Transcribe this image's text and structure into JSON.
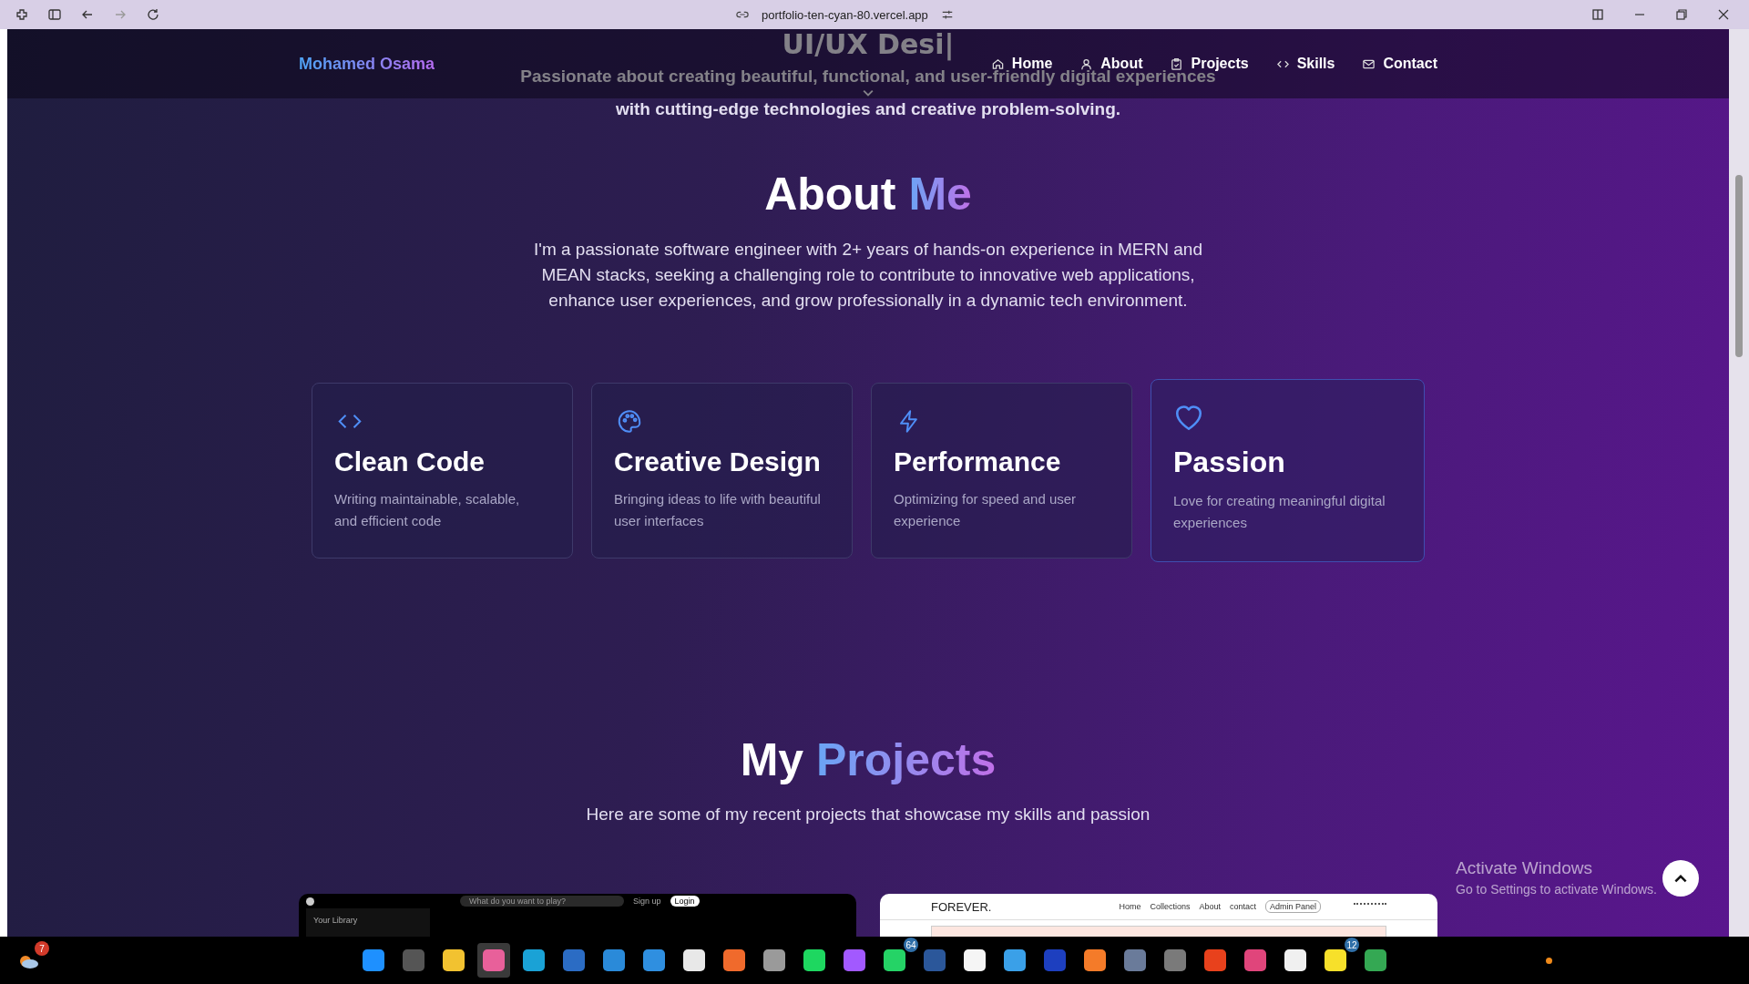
{
  "browser": {
    "address": "portfolio-ten-cyan-80.vercel.app"
  },
  "nav": {
    "logo": "Mohamed Osama",
    "items": [
      {
        "label": "Home",
        "kind": "home"
      },
      {
        "label": "About",
        "kind": "user"
      },
      {
        "label": "Projects",
        "kind": "clipboard"
      },
      {
        "label": "Skills",
        "kind": "code"
      },
      {
        "label": "Contact",
        "kind": "mail"
      }
    ]
  },
  "hero": {
    "title": "UI/UX Desi|",
    "line_1": "Passionate about creating beautiful, functional, and user-friendly digital experiences",
    "line_2": "with cutting-edge technologies and creative problem-solving."
  },
  "about": {
    "title": "About ",
    "title_accent": "Me",
    "text": "I'm a passionate software engineer with 2+ years of hands-on experience in MERN and MEAN stacks, seeking a challenging role to contribute to innovative web applications, enhance user experiences, and grow professionally in a dynamic tech environment.",
    "cards": [
      {
        "kind": "code",
        "title": "Clean Code",
        "text": "Writing maintainable, scalable, and efficient code",
        "selected": false
      },
      {
        "kind": "palette",
        "title": "Creative Design",
        "text": "Bringing ideas to life with beautiful user interfaces",
        "selected": false
      },
      {
        "kind": "bolt",
        "title": "Performance",
        "text": "Optimizing for speed and user experience",
        "selected": false
      },
      {
        "kind": "heart",
        "title": "Passion",
        "text": "Love for creating meaningful digital experiences",
        "selected": true
      }
    ]
  },
  "projects": {
    "title": "My ",
    "title_accent": "Projects",
    "text": "Here are some of my recent projects that showcase my skills and passion",
    "previews": [
      {
        "kind": "dark",
        "search": "What do you want to play?",
        "library": "Your Library",
        "signup": "Sign up",
        "login": "Login"
      },
      {
        "kind": "light",
        "logo": "FOREVER.",
        "links": [
          "Home",
          "Collections",
          "About",
          "contact"
        ],
        "admin": "Admin Panel"
      }
    ]
  },
  "activation": {
    "title": "Activate Windows",
    "text": "Go to Settings to activate Windows."
  },
  "taskbar": {
    "weather_badge": "7",
    "apps": [
      {
        "color": "#1e90ff",
        "selected": false
      },
      {
        "color": "#555555",
        "selected": false
      },
      {
        "color": "#f2c230",
        "selected": false
      },
      {
        "color": "#e8609a",
        "selected": true
      },
      {
        "color": "#1aa2d6",
        "selected": false
      },
      {
        "color": "#2b6cc4",
        "selected": false
      },
      {
        "color": "#2a8ad9",
        "selected": false
      },
      {
        "color": "#2f8fe0",
        "selected": false
      },
      {
        "color": "#e8e8e8",
        "selected": false
      },
      {
        "color": "#f06a2c",
        "selected": false
      },
      {
        "color": "#9a9a9a",
        "selected": false
      },
      {
        "color": "#1ed760",
        "selected": false
      },
      {
        "color": "#a259ff",
        "selected": false
      },
      {
        "color": "#25d366",
        "badge": "64",
        "selected": false
      },
      {
        "color": "#2b579a",
        "selected": false
      },
      {
        "color": "#f5f5f5",
        "selected": false
      },
      {
        "color": "#3aa0e8",
        "selected": false
      },
      {
        "color": "#1d3fbf",
        "selected": false
      },
      {
        "color": "#f47b29",
        "selected": false
      },
      {
        "color": "#6a7b9a",
        "selected": false
      },
      {
        "color": "#7a7a7a",
        "selected": false
      },
      {
        "color": "#e8411c",
        "selected": false
      },
      {
        "color": "#e0457b",
        "selected": false
      },
      {
        "color": "#f0f0f0",
        "selected": false
      },
      {
        "color": "#f7e02a",
        "badge": "12",
        "selected": false
      },
      {
        "color": "#34a853",
        "selected": false
      }
    ]
  }
}
